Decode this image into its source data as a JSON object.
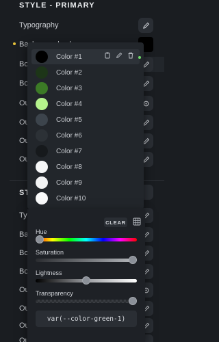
{
  "sections": {
    "primary_title": "STYLE - PRIMARY",
    "secondary_title_partial": "STY"
  },
  "rows_top": [
    {
      "label": "Typography",
      "icon": "pencil-icon"
    },
    {
      "label": "Background color",
      "icon": "color-swatch"
    },
    {
      "label": "Bo",
      "icon": "pencil-icon"
    },
    {
      "label": "Bo",
      "icon": "pencil-icon"
    },
    {
      "label": "Ou",
      "icon": "gear-icon"
    },
    {
      "label": "Ou",
      "icon": "pencil-icon"
    },
    {
      "label": "Ou",
      "icon": "pencil-icon"
    },
    {
      "label": "Ou",
      "icon": "pencil-icon"
    }
  ],
  "rows_bottom": [
    {
      "label": "Typ"
    },
    {
      "label": "Ba"
    },
    {
      "label": "Bo"
    },
    {
      "label": "Bo"
    },
    {
      "label": "Ou"
    },
    {
      "label": "Ou"
    },
    {
      "label": "Ou"
    },
    {
      "label": "Ou"
    }
  ],
  "color_list": [
    {
      "name": "Color #1",
      "color": "#000000"
    },
    {
      "name": "Color #2",
      "color": "#1d3518"
    },
    {
      "name": "Color #3",
      "color": "#3c7a26"
    },
    {
      "name": "Color #4",
      "color": "#b4f28c"
    },
    {
      "name": "Color #5",
      "color": "#3c444c"
    },
    {
      "name": "Color #6",
      "color": "#2c3136"
    },
    {
      "name": "Color #7",
      "color": "#16191c"
    },
    {
      "name": "Color #8",
      "color": "#f6f7f8"
    },
    {
      "name": "Color #9",
      "color": "#f2f3f4"
    },
    {
      "name": "Color #10",
      "color": "#f9fafb"
    }
  ],
  "picker": {
    "clear_label": "CLEAR",
    "hue_label": "Hue",
    "saturation_label": "Saturation",
    "lightness_label": "Lightness",
    "transparency_label": "Transparency",
    "hue_value": 0,
    "saturation_value": 1.0,
    "lightness_value": 0.5,
    "transparency_value": 1.0,
    "css_var": "var(--color-green-1)"
  }
}
